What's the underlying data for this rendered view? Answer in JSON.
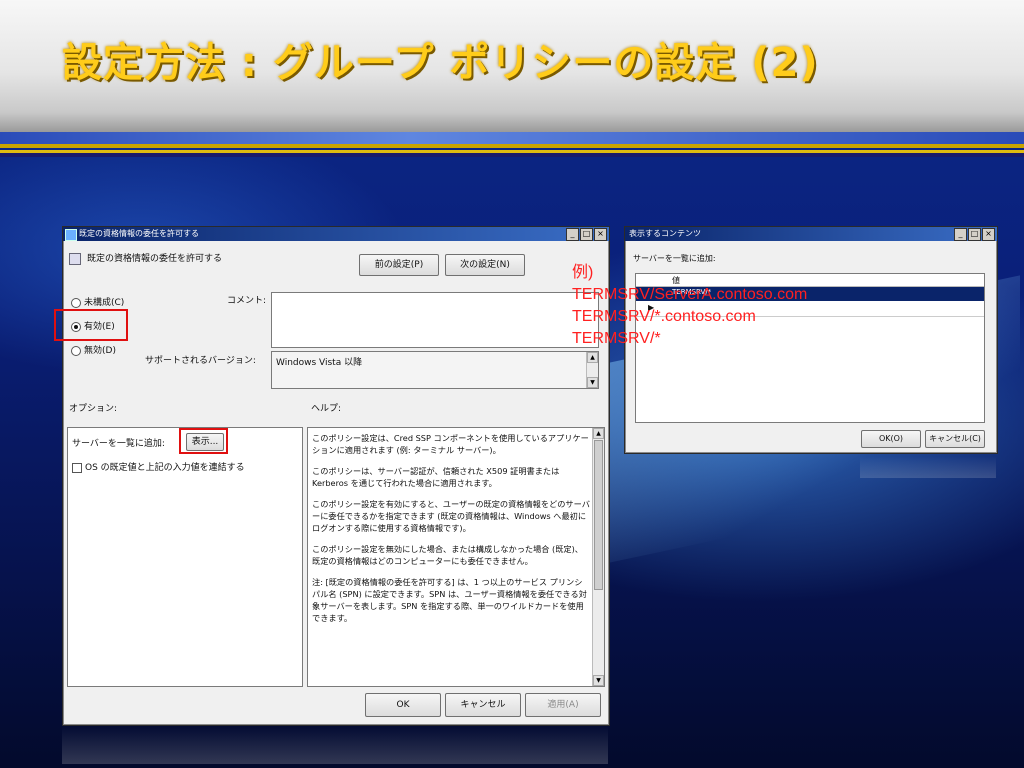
{
  "slide": {
    "title": "設定方法 : グループ ポリシーの設定 (2)"
  },
  "policy_window": {
    "title": "既定の資格情報の委任を許可する",
    "heading": "既定の資格情報の委任を許可する",
    "prev_button": "前の設定(P)",
    "next_button": "次の設定(N)",
    "radio_not_configured": "未構成(C)",
    "radio_enabled": "有効(E)",
    "radio_disabled": "無効(D)",
    "comment_label": "コメント:",
    "supported_label": "サポートされるバージョン:",
    "supported_value": "Windows Vista 以降",
    "options_label": "オプション:",
    "help_label": "ヘルプ:",
    "server_add_label": "サーバーを一覧に追加:",
    "show_button": "表示...",
    "concat_checkbox": "OS の既定値と上記の入力値を連結する",
    "help_paragraphs": [
      "このポリシー設定は、Cred SSP コンポーネントを使用しているアプリケーションに適用されます (例: ターミナル サーバー)。",
      "このポリシーは、サーバー認証が、信頼された X509 証明書または Kerberos を通じて行われた場合に適用されます。",
      "このポリシー設定を有効にすると、ユーザーの既定の資格情報をどのサーバーに委任できるかを指定できます (既定の資格情報は、Windows へ最初にログオンする際に使用する資格情報です)。",
      "このポリシー設定を無効にした場合、または構成しなかった場合 (既定)、既定の資格情報はどのコンピューターにも委任できません。",
      "注: [既定の資格情報の委任を許可する] は、1 つ以上のサービス プリンシパル名 (SPN) に設定できます。SPN は、ユーザー資格情報を委任できる対象サーバーを表します。SPN を指定する際、単一のワイルドカードを使用できます。"
    ],
    "ok_button": "OK",
    "cancel_button": "キャンセル",
    "apply_button": "適用(A)"
  },
  "content_window": {
    "title": "表示するコンテンツ",
    "label": "サーバーを一覧に追加:",
    "column_header": "値",
    "row_value": "TERMSRV/*",
    "ok_button": "OK(O)",
    "cancel_button": "キャンセル(C)"
  },
  "example": {
    "heading": "例)",
    "lines": [
      "TERMSRV/ServerA.contoso.com",
      "TERMSRV/*.contoso.com",
      "TERMSRV/*"
    ]
  },
  "colors": {
    "title": "#ffcc1a",
    "highlight": "#e01010",
    "example_text": "#ff2020"
  }
}
